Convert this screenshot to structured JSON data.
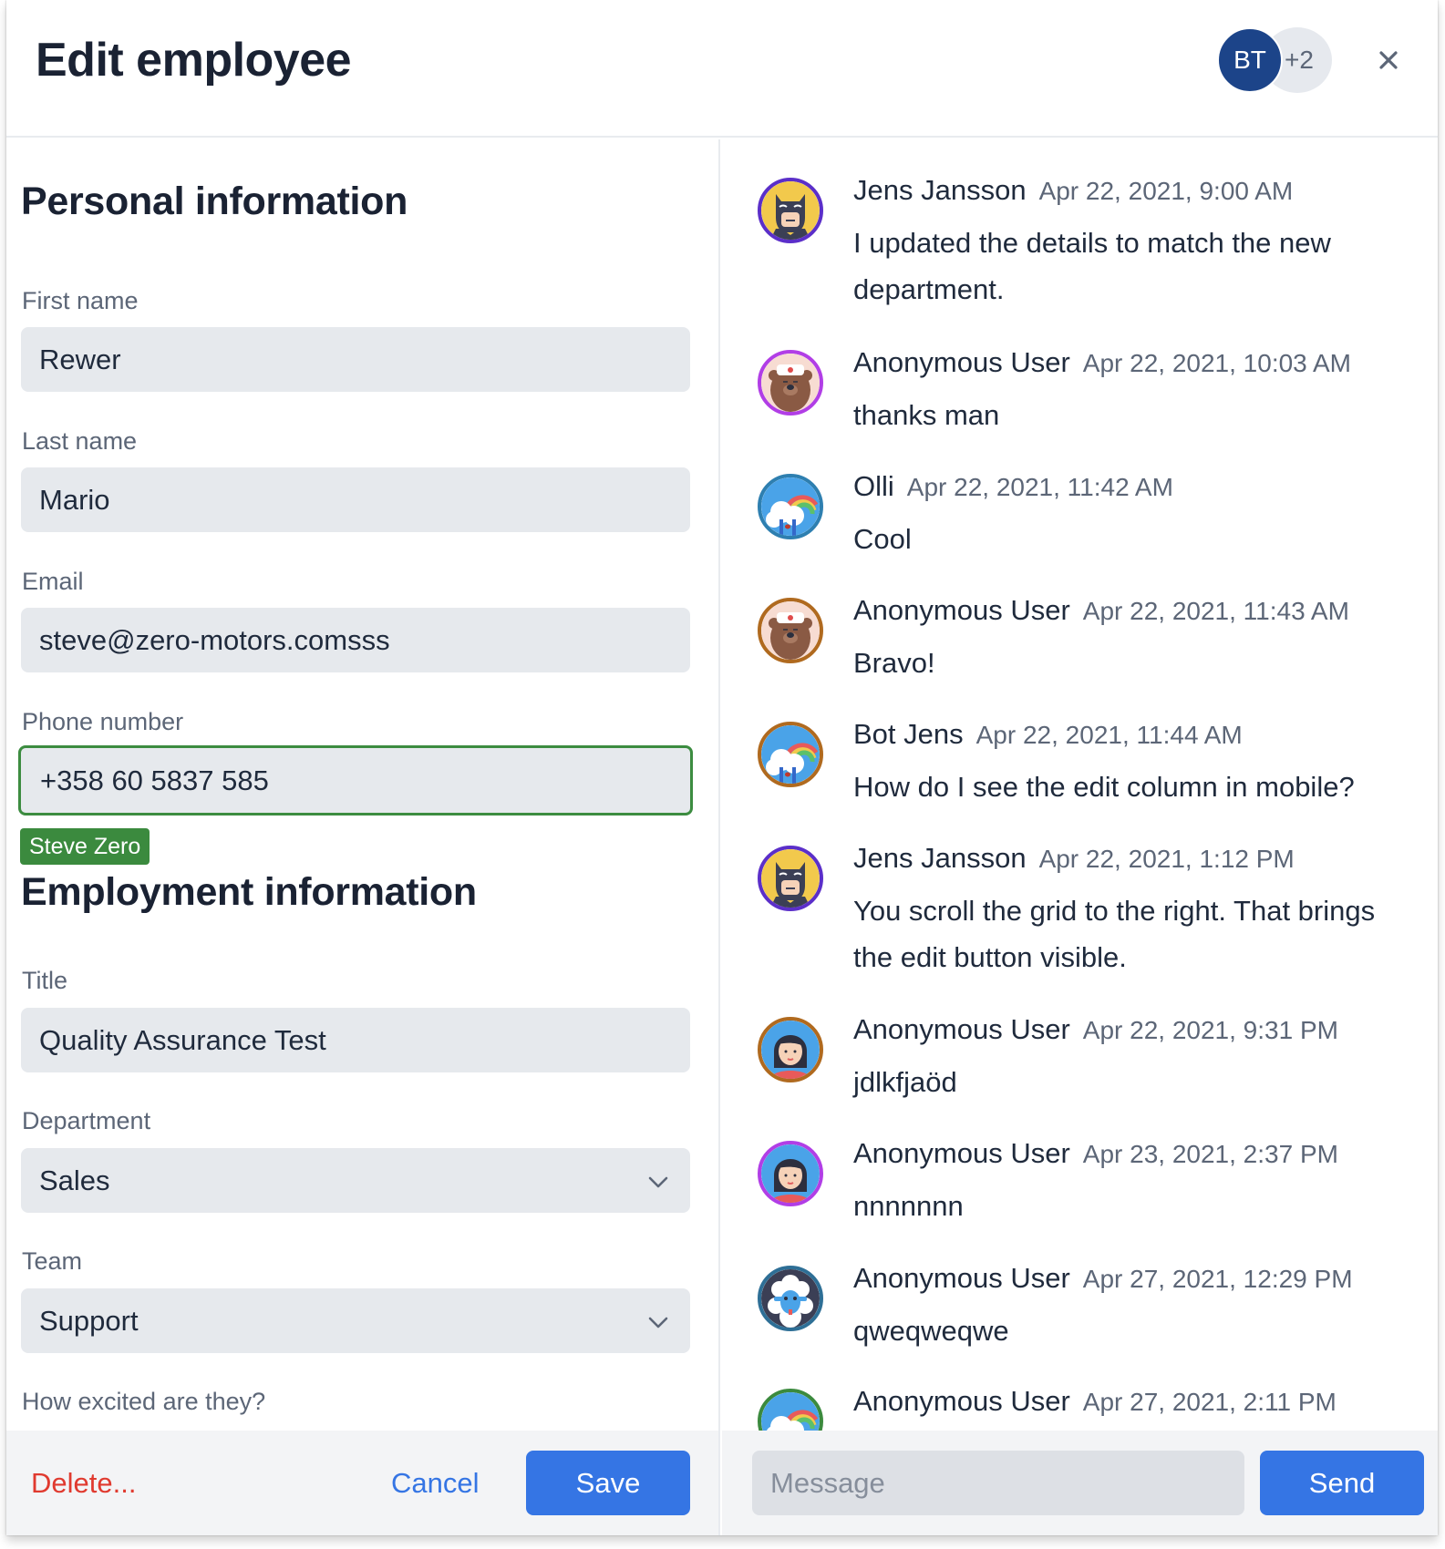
{
  "header": {
    "title": "Edit employee",
    "presence": {
      "initials": "BT",
      "more_count": "+2",
      "avatar_color": "#1c4489"
    },
    "close_icon": "close-icon"
  },
  "form": {
    "personal_heading": "Personal information",
    "employment_heading": "Employment information",
    "fields": {
      "first_name": {
        "label": "First name",
        "value": "Rewer"
      },
      "last_name": {
        "label": "Last name",
        "value": "Mario"
      },
      "email": {
        "label": "Email",
        "value": "steve@zero-motors.comsss"
      },
      "phone": {
        "label": "Phone number",
        "value": "+358 60 5837 585",
        "collaborator_badge": "Steve Zero",
        "focus_color": "#3b8a3e"
      },
      "title": {
        "label": "Title",
        "value": "Quality Assurance Test"
      },
      "department": {
        "label": "Department",
        "value": "Sales"
      },
      "team": {
        "label": "Team",
        "value": "Support"
      },
      "excitement": {
        "label": "How excited are they?"
      }
    }
  },
  "footer": {
    "delete_label": "Delete...",
    "cancel_label": "Cancel",
    "save_label": "Save"
  },
  "chat": {
    "message_placeholder": "Message",
    "message_value": "",
    "send_label": "Send",
    "messages": [
      {
        "author": "Jens Jansson",
        "time": "Apr 22, 2021, 9:00 AM",
        "text": "I updated the details to match the new department.",
        "avatar": "batman",
        "ring": "#5b2fc9"
      },
      {
        "author": "Anonymous User",
        "time": "Apr 22, 2021, 10:03 AM",
        "text": "thanks man",
        "avatar": "bear",
        "ring": "#b13ee6"
      },
      {
        "author": "Olli",
        "time": "Apr 22, 2021, 11:42 AM",
        "text": "Cool",
        "avatar": "rainbow",
        "ring": "#2e7fb0"
      },
      {
        "author": "Anonymous User",
        "time": "Apr 22, 2021, 11:43 AM",
        "text": "Bravo!",
        "avatar": "bear",
        "ring": "#b06a1f"
      },
      {
        "author": "Bot Jens",
        "time": "Apr 22, 2021, 11:44 AM",
        "text": "How do I see the edit column in mobile?",
        "avatar": "rainbow",
        "ring": "#b06a1f"
      },
      {
        "author": "Jens Jansson",
        "time": "Apr 22, 2021, 1:12 PM",
        "text": "You scroll the grid to the right. That brings the edit button visible.",
        "avatar": "batman",
        "ring": "#5b2fc9"
      },
      {
        "author": "Anonymous User",
        "time": "Apr 22, 2021, 9:31 PM",
        "text": "jdlkfjaöd",
        "avatar": "girl",
        "ring": "#b06a1f"
      },
      {
        "author": "Anonymous User",
        "time": "Apr 23, 2021, 2:37 PM",
        "text": "nnnnnnn",
        "avatar": "girl",
        "ring": "#b13ee6"
      },
      {
        "author": "Anonymous User",
        "time": "Apr 27, 2021, 12:29 PM",
        "text": "qweqweqwe",
        "avatar": "sheep",
        "ring": "#2e6f96"
      },
      {
        "author": "Anonymous User",
        "time": "Apr 27, 2021, 2:11 PM",
        "text": "",
        "avatar": "rainbow",
        "ring": "#3b8a3e"
      }
    ]
  },
  "colors": {
    "primary": "#3575e4",
    "danger": "#e03a2f",
    "field_bg": "#e6e9ed",
    "footer_bg": "#f3f4f6"
  }
}
